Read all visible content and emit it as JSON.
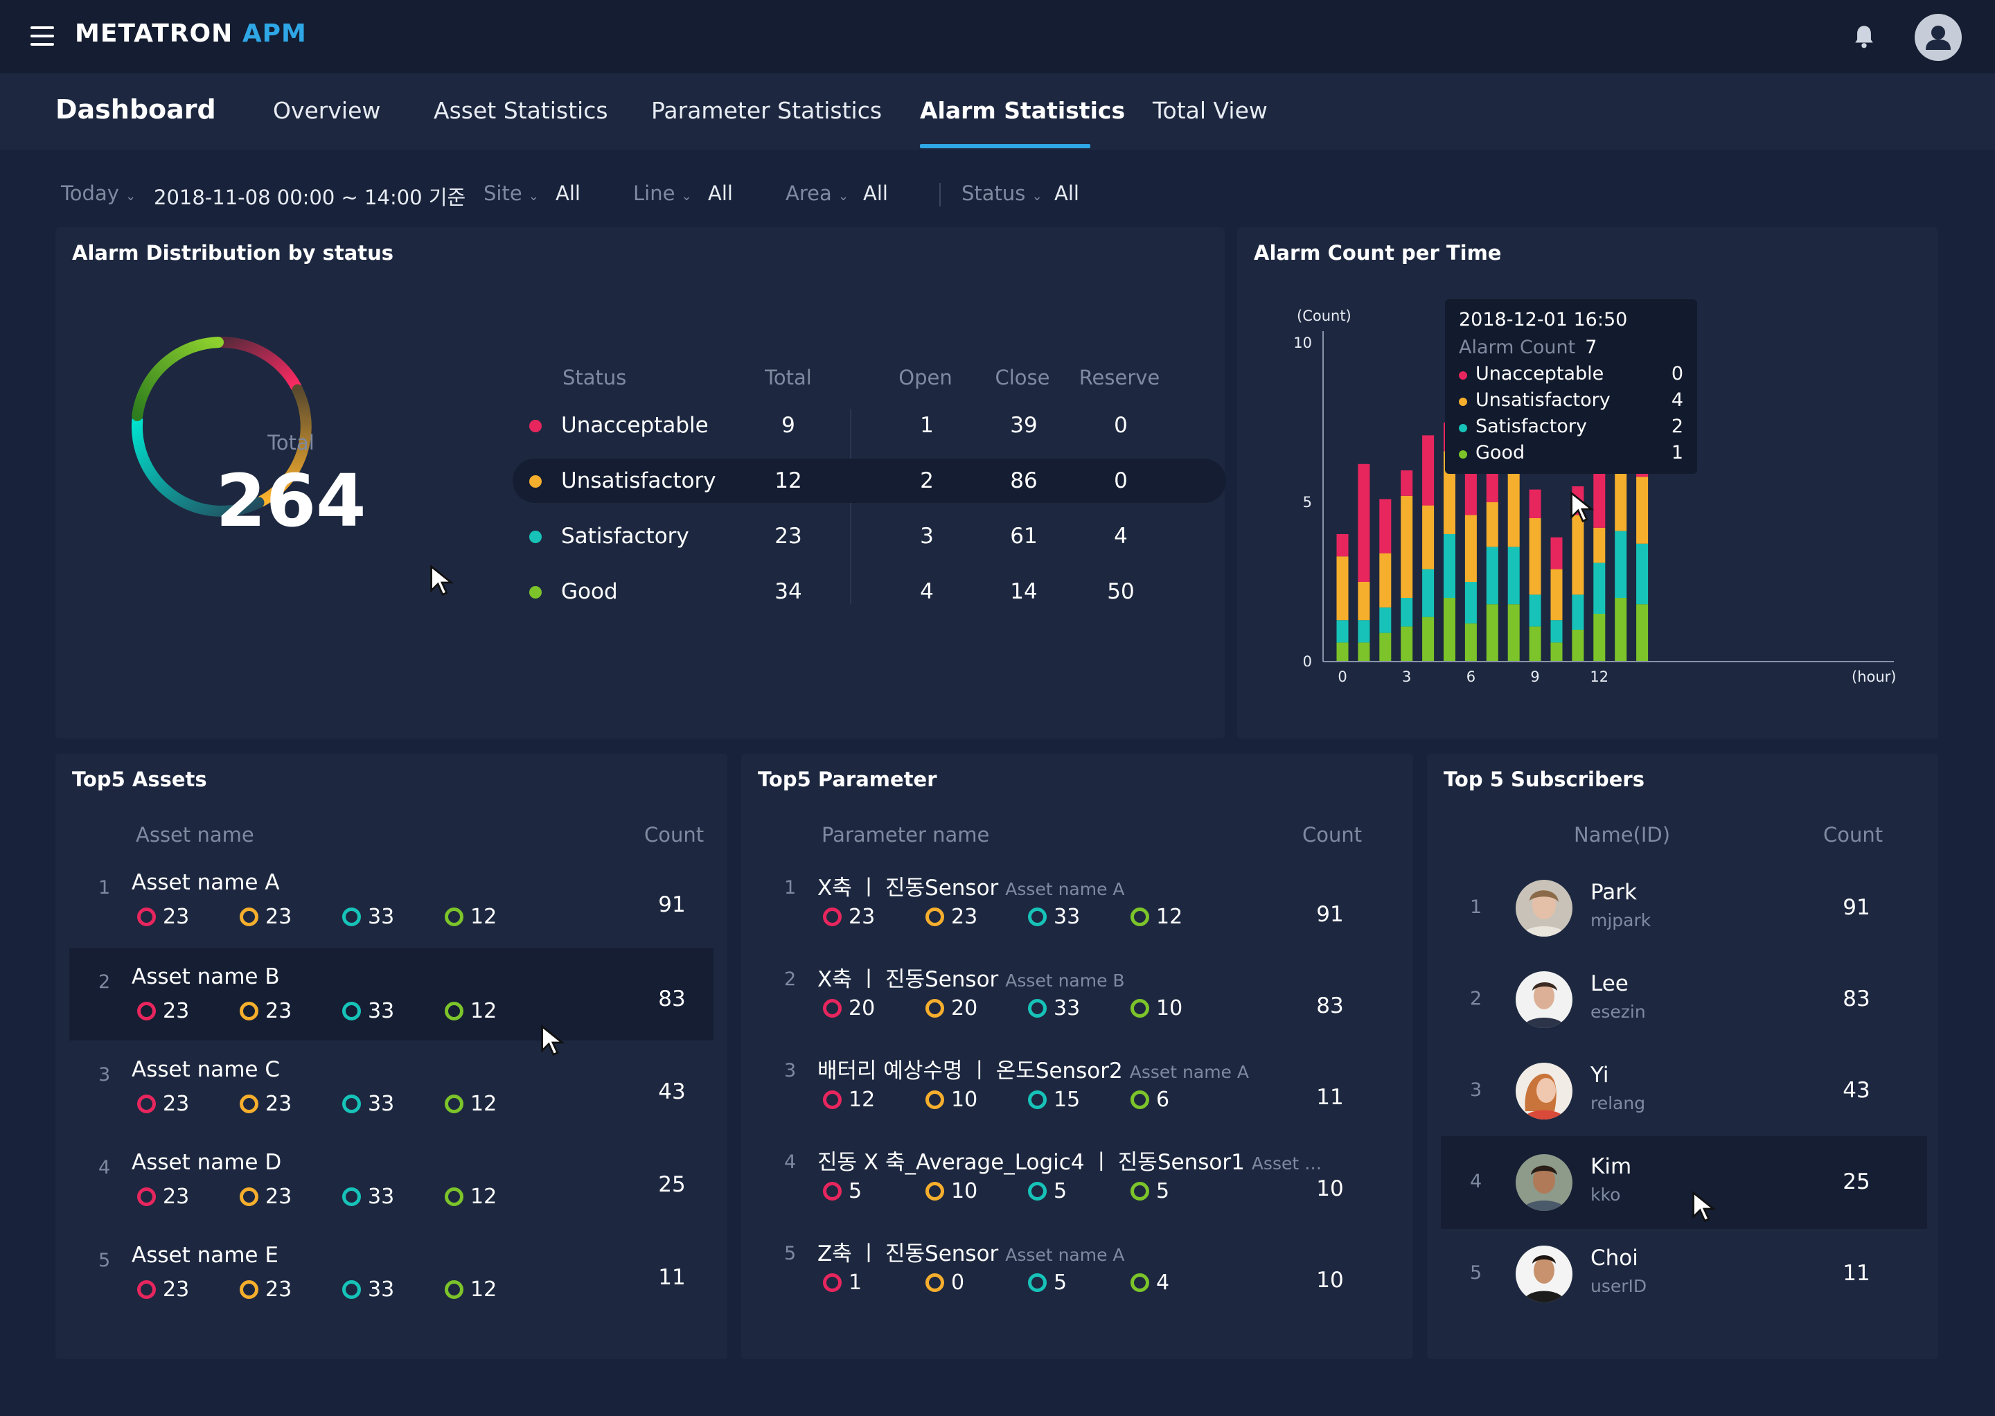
{
  "app": {
    "brand_main": "METATRON",
    "brand_accent": "APM"
  },
  "icons": {
    "menu": "hamburger-icon",
    "bell": "bell-icon",
    "user": "user-avatar-icon",
    "chevron": "chevron-down-icon",
    "cursor": "mouse-cursor-icon"
  },
  "nav": {
    "title": "Dashboard",
    "tabs": [
      "Overview",
      "Asset Statistics",
      "Parameter Statistics",
      "Alarm Statistics",
      "Total View"
    ],
    "active_tab": "Alarm Statistics"
  },
  "filters": {
    "period": "Today",
    "date_range": "2018-11-08 00:00 ~ 14:00 기준",
    "site": {
      "label": "Site",
      "value": "All"
    },
    "line": {
      "label": "Line",
      "value": "All"
    },
    "area": {
      "label": "Area",
      "value": "All"
    },
    "status": {
      "label": "Status",
      "value": "All"
    }
  },
  "colors": {
    "unacceptable": "#e8265e",
    "unsatisfactory": "#f6ae2d",
    "satisfactory": "#17c3b8",
    "good": "#7cc42a",
    "accent": "#2fa7e6"
  },
  "distribution": {
    "title": "Alarm Distribution by status",
    "total_label": "Total",
    "total_value": "264",
    "headers": {
      "status": "Status",
      "total": "Total",
      "open": "Open",
      "close": "Close",
      "reserve": "Reserve"
    },
    "rows": [
      {
        "status": "Unacceptable",
        "total": "9",
        "open": "1",
        "close": "39",
        "reserve": "0"
      },
      {
        "status": "Unsatisfactory",
        "total": "12",
        "open": "2",
        "close": "86",
        "reserve": "0"
      },
      {
        "status": "Satisfactory",
        "total": "23",
        "open": "3",
        "close": "61",
        "reserve": "4"
      },
      {
        "status": "Good",
        "total": "34",
        "open": "4",
        "close": "14",
        "reserve": "50"
      }
    ]
  },
  "alarm_chart": {
    "title": "Alarm Count per Time",
    "ylabel": "(Count)",
    "xunit": "(hour)",
    "tooltip": {
      "time": "2018-12-01 16:50",
      "count_label": "Alarm Count",
      "count_value": "7",
      "rows": [
        {
          "label": "Unacceptable",
          "value": "0"
        },
        {
          "label": "Unsatisfactory",
          "value": "4"
        },
        {
          "label": "Satisfactory",
          "value": "2"
        },
        {
          "label": "Good",
          "value": "1"
        }
      ]
    }
  },
  "chart_data": {
    "type": "bar",
    "stacked": true,
    "title": "Alarm Count per Time",
    "ylabel": "(Count)",
    "xlabel": "(hour)",
    "ylim": [
      0,
      10
    ],
    "yticks": [
      "0",
      "5",
      "10"
    ],
    "xticks": [
      "0",
      "3",
      "6",
      "9",
      "12"
    ],
    "categories": [
      "0",
      "1",
      "2",
      "3",
      "4",
      "5",
      "6",
      "7",
      "8",
      "9",
      "10",
      "11",
      "12",
      "13",
      "14"
    ],
    "series": [
      {
        "name": "Good",
        "color": "#7cc42a",
        "values": [
          0.6,
          0.6,
          0.9,
          1.1,
          1.4,
          2,
          1.2,
          1.8,
          1.8,
          1.1,
          0.6,
          1,
          1.5,
          2,
          1.8
        ]
      },
      {
        "name": "Satisfactory",
        "color": "#17c3b8",
        "values": [
          0.7,
          0.7,
          0.8,
          0.9,
          1.5,
          2,
          1.3,
          1.8,
          1.8,
          1,
          0.7,
          1.1,
          1.6,
          2.1,
          1.9
        ]
      },
      {
        "name": "Unsatisfactory",
        "color": "#f6ae2d",
        "values": [
          2,
          1.2,
          1.7,
          3.2,
          2,
          2.6,
          2.1,
          1.4,
          3.2,
          2.4,
          1.6,
          2.5,
          1.1,
          1.8,
          2.1
        ]
      },
      {
        "name": "Unacceptable",
        "color": "#e8265e",
        "values": [
          0.7,
          3.7,
          1.7,
          0.8,
          2.2,
          0.9,
          1.9,
          2.5,
          1.3,
          0.9,
          1,
          0.9,
          2.3,
          0.8,
          2.7
        ]
      }
    ]
  },
  "top_assets": {
    "title": "Top5 Assets",
    "headers": {
      "name": "Asset name",
      "count": "Count"
    },
    "rows": [
      {
        "rank": "1",
        "name": "Asset name A",
        "u": "23",
        "us": "23",
        "s": "33",
        "g": "12",
        "count": "91"
      },
      {
        "rank": "2",
        "name": "Asset name B",
        "u": "23",
        "us": "23",
        "s": "33",
        "g": "12",
        "count": "83"
      },
      {
        "rank": "3",
        "name": "Asset name C",
        "u": "23",
        "us": "23",
        "s": "33",
        "g": "12",
        "count": "43"
      },
      {
        "rank": "4",
        "name": "Asset name D",
        "u": "23",
        "us": "23",
        "s": "33",
        "g": "12",
        "count": "25"
      },
      {
        "rank": "5",
        "name": "Asset name E",
        "u": "23",
        "us": "23",
        "s": "33",
        "g": "12",
        "count": "11"
      }
    ]
  },
  "top_params": {
    "title": "Top5 Parameter",
    "headers": {
      "name": "Parameter name",
      "count": "Count"
    },
    "rows": [
      {
        "rank": "1",
        "name": "X축 ㅣ 진동Sensor",
        "asset": "Asset name A",
        "u": "23",
        "us": "23",
        "s": "33",
        "g": "12",
        "count": "91"
      },
      {
        "rank": "2",
        "name": "X축 ㅣ 진동Sensor",
        "asset": "Asset name B",
        "u": "20",
        "us": "20",
        "s": "33",
        "g": "10",
        "count": "83"
      },
      {
        "rank": "3",
        "name": "배터리 예상수명 ㅣ 온도Sensor2",
        "asset": "Asset name A",
        "u": "12",
        "us": "10",
        "s": "15",
        "g": "6",
        "count": "11"
      },
      {
        "rank": "4",
        "name": "진동 X 축_Average_Logic4 ㅣ 진동Sensor1",
        "asset": "Asset …",
        "u": "5",
        "us": "10",
        "s": "5",
        "g": "5",
        "count": "10"
      },
      {
        "rank": "5",
        "name": "Z축 ㅣ 진동Sensor",
        "asset": "Asset name A",
        "u": "1",
        "us": "0",
        "s": "5",
        "g": "4",
        "count": "10"
      }
    ]
  },
  "top_subscribers": {
    "title": "Top 5 Subscribers",
    "headers": {
      "name": "Name(ID)",
      "count": "Count"
    },
    "rows": [
      {
        "rank": "1",
        "name": "Park",
        "id": "mjpark",
        "count": "91"
      },
      {
        "rank": "2",
        "name": "Lee",
        "id": "esezin",
        "count": "83"
      },
      {
        "rank": "3",
        "name": "Yi",
        "id": "relang",
        "count": "43"
      },
      {
        "rank": "4",
        "name": "Kim",
        "id": "kko",
        "count": "25"
      },
      {
        "rank": "5",
        "name": "Choi",
        "id": "userID",
        "count": "11"
      }
    ]
  }
}
